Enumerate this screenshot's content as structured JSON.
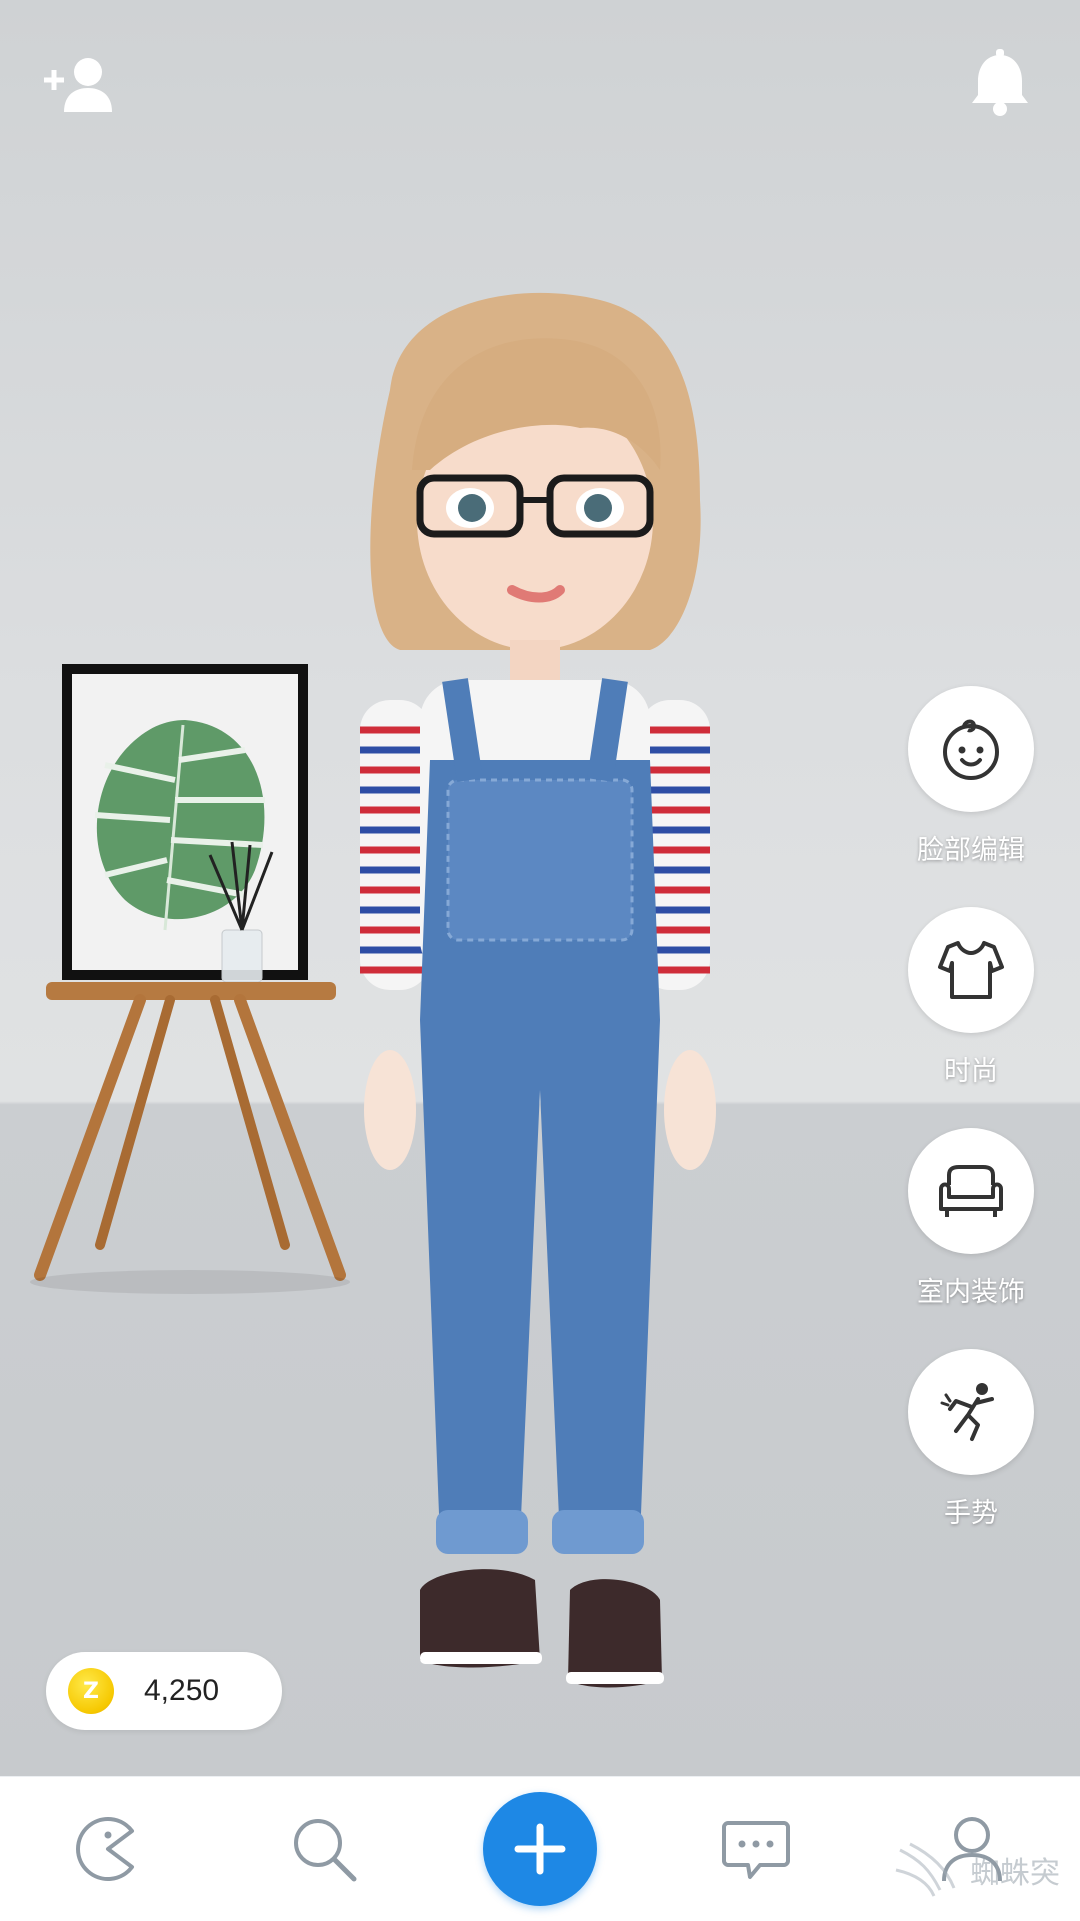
{
  "side_menu": [
    {
      "label": "脸部编辑",
      "icon": "face-icon"
    },
    {
      "label": "时尚",
      "icon": "shirt-icon"
    },
    {
      "label": "室内装饰",
      "icon": "sofa-icon"
    },
    {
      "label": "手势",
      "icon": "dance-gesture-icon"
    }
  ],
  "wallet": {
    "coin_symbol": "Z",
    "amount": "4,250"
  },
  "tabbar": [
    {
      "name": "home-tab",
      "icon": "pacman-home-icon"
    },
    {
      "name": "search-tab",
      "icon": "search-icon"
    },
    {
      "name": "create-tab",
      "icon": "plus-icon"
    },
    {
      "name": "chat-tab",
      "icon": "chat-bubble-icon"
    },
    {
      "name": "profile-tab",
      "icon": "profile-icon"
    }
  ],
  "watermark": {
    "text": "蜘蛛突"
  },
  "colors": {
    "accent": "#1e88e5",
    "icon_gray": "#8f9aa4",
    "side_label": "#ffffff"
  }
}
